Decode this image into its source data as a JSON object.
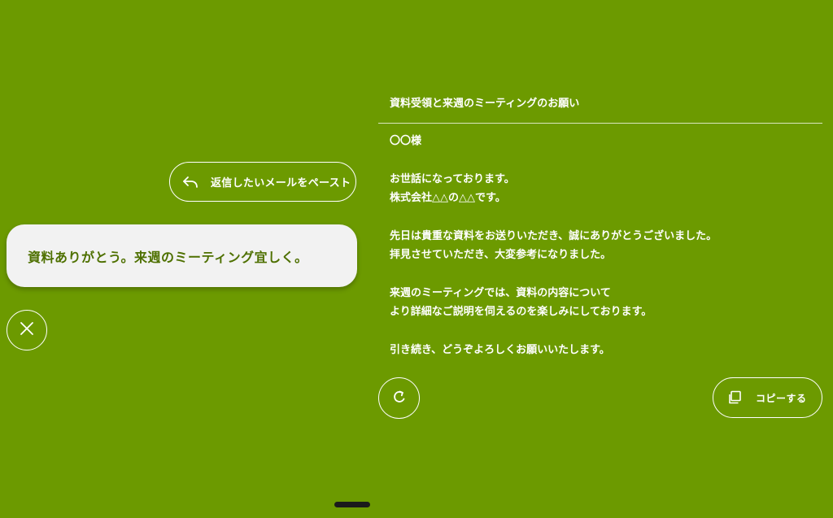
{
  "colors": {
    "background": "#6c9a00",
    "bubble_background": "#f2f2f2",
    "bubble_text": "#4e7000",
    "foreground": "#ffffff"
  },
  "paste_button": {
    "label": "返信したいメールをペースト",
    "icon": "reply-arrow-icon"
  },
  "input": {
    "text": "資料ありがとう。来週のミーティング宜しく。"
  },
  "close_button": {
    "icon": "close-icon"
  },
  "reply": {
    "subject": "資料受領と来週のミーティングのお願い",
    "paragraphs": [
      [
        "〇〇様"
      ],
      [
        "お世話になっております。",
        "株式会社△△の△△です。"
      ],
      [
        "先日は貴重な資料をお送りいただき、誠にありがとうございました。",
        "拝見させていただき、大変参考になりました。"
      ],
      [
        "来週のミーティングでは、資料の内容について",
        "より詳細なご説明を伺えるのを楽しみにしております。"
      ],
      [
        "引き続き、どうぞよろしくお願いいたします。"
      ]
    ]
  },
  "refresh_button": {
    "icon": "refresh-icon"
  },
  "copy_button": {
    "label": "コピーする",
    "icon": "copy-icon"
  }
}
